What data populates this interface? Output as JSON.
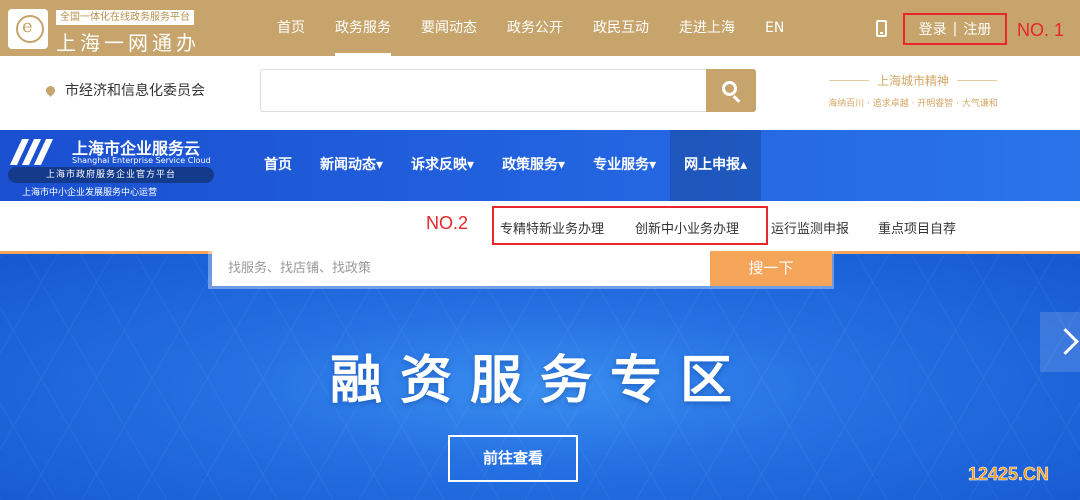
{
  "gov_header": {
    "tagline": "全国一体化在线政务服务平台",
    "name": "上海一网通办",
    "nav": [
      {
        "label": "首页",
        "active": false
      },
      {
        "label": "政务服务",
        "active": true
      },
      {
        "label": "要闻动态",
        "active": false
      },
      {
        "label": "政务公开",
        "active": false
      },
      {
        "label": "政民互动",
        "active": false
      },
      {
        "label": "走进上海",
        "active": false
      },
      {
        "label": "EN",
        "active": false
      }
    ],
    "login": "登录",
    "separator": "|",
    "register": "注册",
    "marker": "NO. 1"
  },
  "search_row": {
    "department": "市经济和信息化委员会",
    "search_placeholder": "",
    "spirit_title": "上海城市精神",
    "spirit_words": "海纳百川 · 追求卓越 · 开明睿智 · 大气谦和"
  },
  "cloud_header": {
    "title": "上海市企业服务云",
    "subtitle": "Shanghai Enterprise Service Cloud",
    "pill": "上海市政府服务企业官方平台",
    "operator": "上海市中小企业发展服务中心运营",
    "nav": [
      {
        "label": "首页",
        "active": false
      },
      {
        "label": "新闻动态▾",
        "active": false
      },
      {
        "label": "诉求反映▾",
        "active": false
      },
      {
        "label": "政策服务▾",
        "active": false
      },
      {
        "label": "专业服务▾",
        "active": false
      },
      {
        "label": "网上申报▴",
        "active": true
      }
    ]
  },
  "submenu": {
    "marker": "NO.2",
    "items": [
      "专精特新业务办理",
      "创新中小业务办理",
      "运行监测申报",
      "重点项目自荐"
    ]
  },
  "banner": {
    "search_placeholder": "找服务、找店铺、找政策",
    "search_button": "搜一下",
    "title": "融资服务专区",
    "cta": "前往查看"
  },
  "watermark": "12425.CN",
  "colors": {
    "gold": "#c7a46b",
    "blue": "#1f5fdc",
    "orange": "#f4a55a",
    "red_highlight": "#e8262b"
  }
}
